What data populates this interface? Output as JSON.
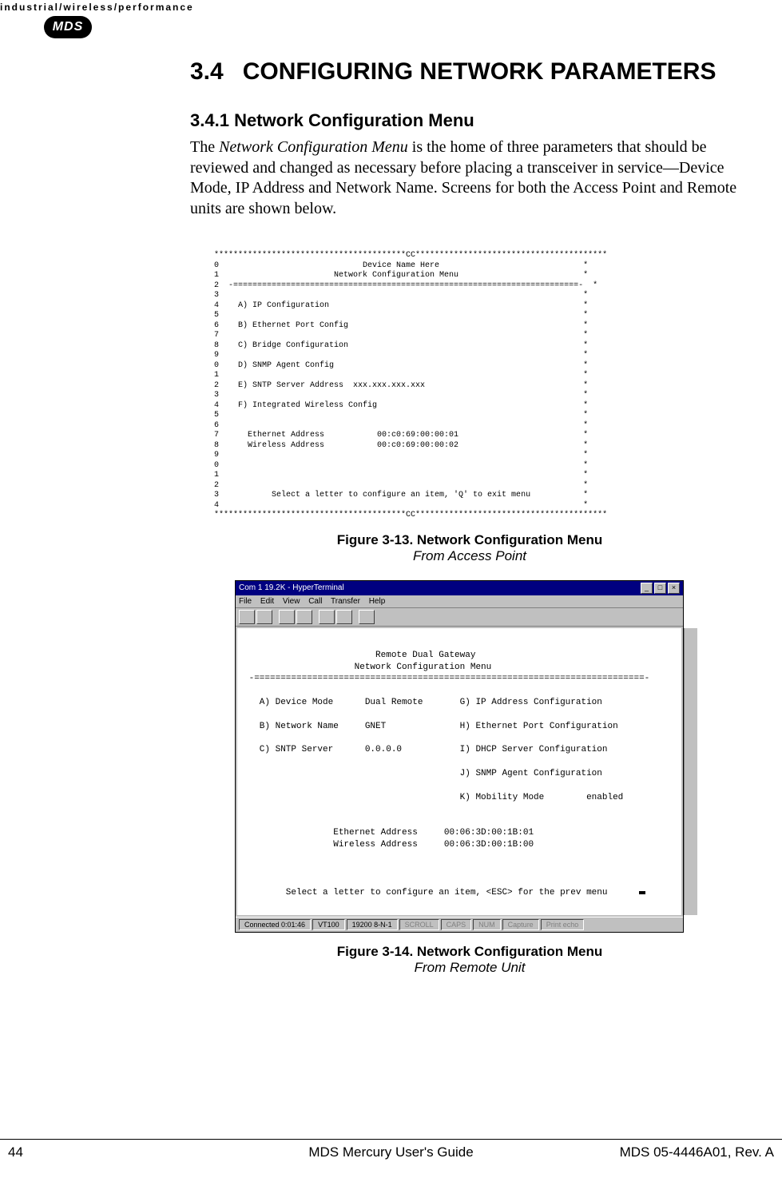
{
  "header": {
    "tagline": "industrial/wireless/performance",
    "logo_text": "MDS"
  },
  "section": {
    "number": "3.4",
    "title": "CONFIGURING NETWORK PARAMETERS"
  },
  "subsection": {
    "number": "3.4.1",
    "title": "Network Configuration Menu"
  },
  "paragraph": {
    "lead_phrase_pre": "The ",
    "lead_phrase_italic": "Network Configuration Menu",
    "body_rest": " is the home of three parameters that should be reviewed and changed as necessary before placing a transceiver in service—Device Mode, IP Address and Network Name. Screens for both the Access Point and Remote units are shown below."
  },
  "terminal_ap": {
    "border_top": "****************************************CC****************************************",
    "line_00": "0                              Device Name Here                              *",
    "line_01": "1                        Network Configuration Menu                          *",
    "line_02": "2  -========================================================================-  *",
    "line_03": "3                                                                            *",
    "line_04": "4    A) IP Configuration                                                     *",
    "line_05": "5                                                                            *",
    "line_06": "6    B) Ethernet Port Config                                                 *",
    "line_07": "7                                                                            *",
    "line_08": "8    C) Bridge Configuration                                                 *",
    "line_09": "9                                                                            *",
    "line_10": "0    D) SNMP Agent Config                                                    *",
    "line_11": "1                                                                            *",
    "line_12": "2    E) SNTP Server Address  xxx.xxx.xxx.xxx                                 *",
    "line_13": "3                                                                            *",
    "line_14": "4    F) Integrated Wireless Config                                           *",
    "line_15": "5                                                                            *",
    "line_16": "6                                                                            *",
    "line_17": "7      Ethernet Address           00:c0:69:00:00:01                          *",
    "line_18": "8      Wireless Address           00:c0:69:00:00:02                          *",
    "line_19": "9                                                                            *",
    "line_20": "0                                                                            *",
    "line_21": "1                                                                            *",
    "line_22": "2                                                                            *",
    "line_23": "3           Select a letter to configure an item, 'Q' to exit menu           *",
    "line_24": "4                                                                            *",
    "border_bot": "****************************************CC****************************************"
  },
  "figure1": {
    "label_bold": "Figure 3-13. Network Configuration Menu",
    "label_italic": "From Access Point"
  },
  "hyperterminal": {
    "titlebar": "Com 1 19.2K - HyperTerminal",
    "menubar": {
      "m0": "File",
      "m1": "Edit",
      "m2": "View",
      "m3": "Call",
      "m4": "Transfer",
      "m5": "Help"
    },
    "body": {
      "l00": "                         Remote Dual Gateway",
      "l01": "                     Network Configuration Menu",
      "l02": " -==========================================================================-",
      "l03": "",
      "l04": "   A) Device Mode      Dual Remote       G) IP Address Configuration",
      "l05": "",
      "l06": "   B) Network Name     GNET              H) Ethernet Port Configuration",
      "l07": "",
      "l08": "   C) SNTP Server      0.0.0.0           I) DHCP Server Configuration",
      "l09": "",
      "l10": "                                         J) SNMP Agent Configuration",
      "l11": "",
      "l12": "                                         K) Mobility Mode        enabled",
      "l13": "",
      "l14": "",
      "l15": "                 Ethernet Address     00:06:3D:00:1B:01",
      "l16": "                 Wireless Address     00:06:3D:00:1B:00",
      "l17": "",
      "l18": "",
      "l19": "",
      "l20": "        Select a letter to configure an item, <ESC> for the prev menu"
    },
    "status": {
      "s0": "Connected 0:01:46",
      "s1": "VT100",
      "s2": "19200 8-N-1",
      "s3": "SCROLL",
      "s4": "CAPS",
      "s5": "NUM",
      "s6": "Capture",
      "s7": "Print echo"
    }
  },
  "figure2": {
    "label_bold": "Figure 3-14. Network Configuration Menu",
    "label_italic": "From Remote Unit"
  },
  "footer": {
    "page_number": "44",
    "center": "MDS Mercury User's Guide",
    "right": "MDS 05-4446A01, Rev. A"
  }
}
